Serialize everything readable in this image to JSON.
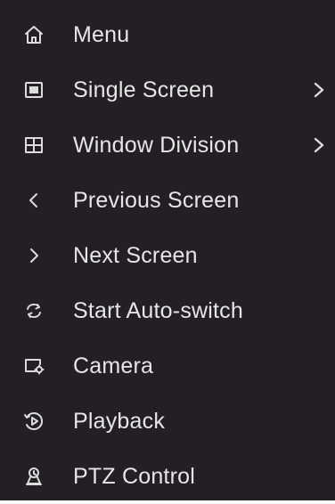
{
  "menu": {
    "items": [
      {
        "label": "Menu",
        "icon": "home-icon",
        "submenu": false
      },
      {
        "label": "Single Screen",
        "icon": "single-screen-icon",
        "submenu": true
      },
      {
        "label": "Window Division",
        "icon": "window-division-icon",
        "submenu": true
      },
      {
        "label": "Previous Screen",
        "icon": "chevron-left-icon",
        "submenu": false
      },
      {
        "label": "Next Screen",
        "icon": "chevron-right-icon",
        "submenu": false
      },
      {
        "label": "Start Auto-switch",
        "icon": "auto-switch-icon",
        "submenu": false
      },
      {
        "label": "Camera",
        "icon": "camera-icon",
        "submenu": false
      },
      {
        "label": "Playback",
        "icon": "playback-icon",
        "submenu": false
      },
      {
        "label": "PTZ Control",
        "icon": "ptz-control-icon",
        "submenu": false
      }
    ]
  }
}
